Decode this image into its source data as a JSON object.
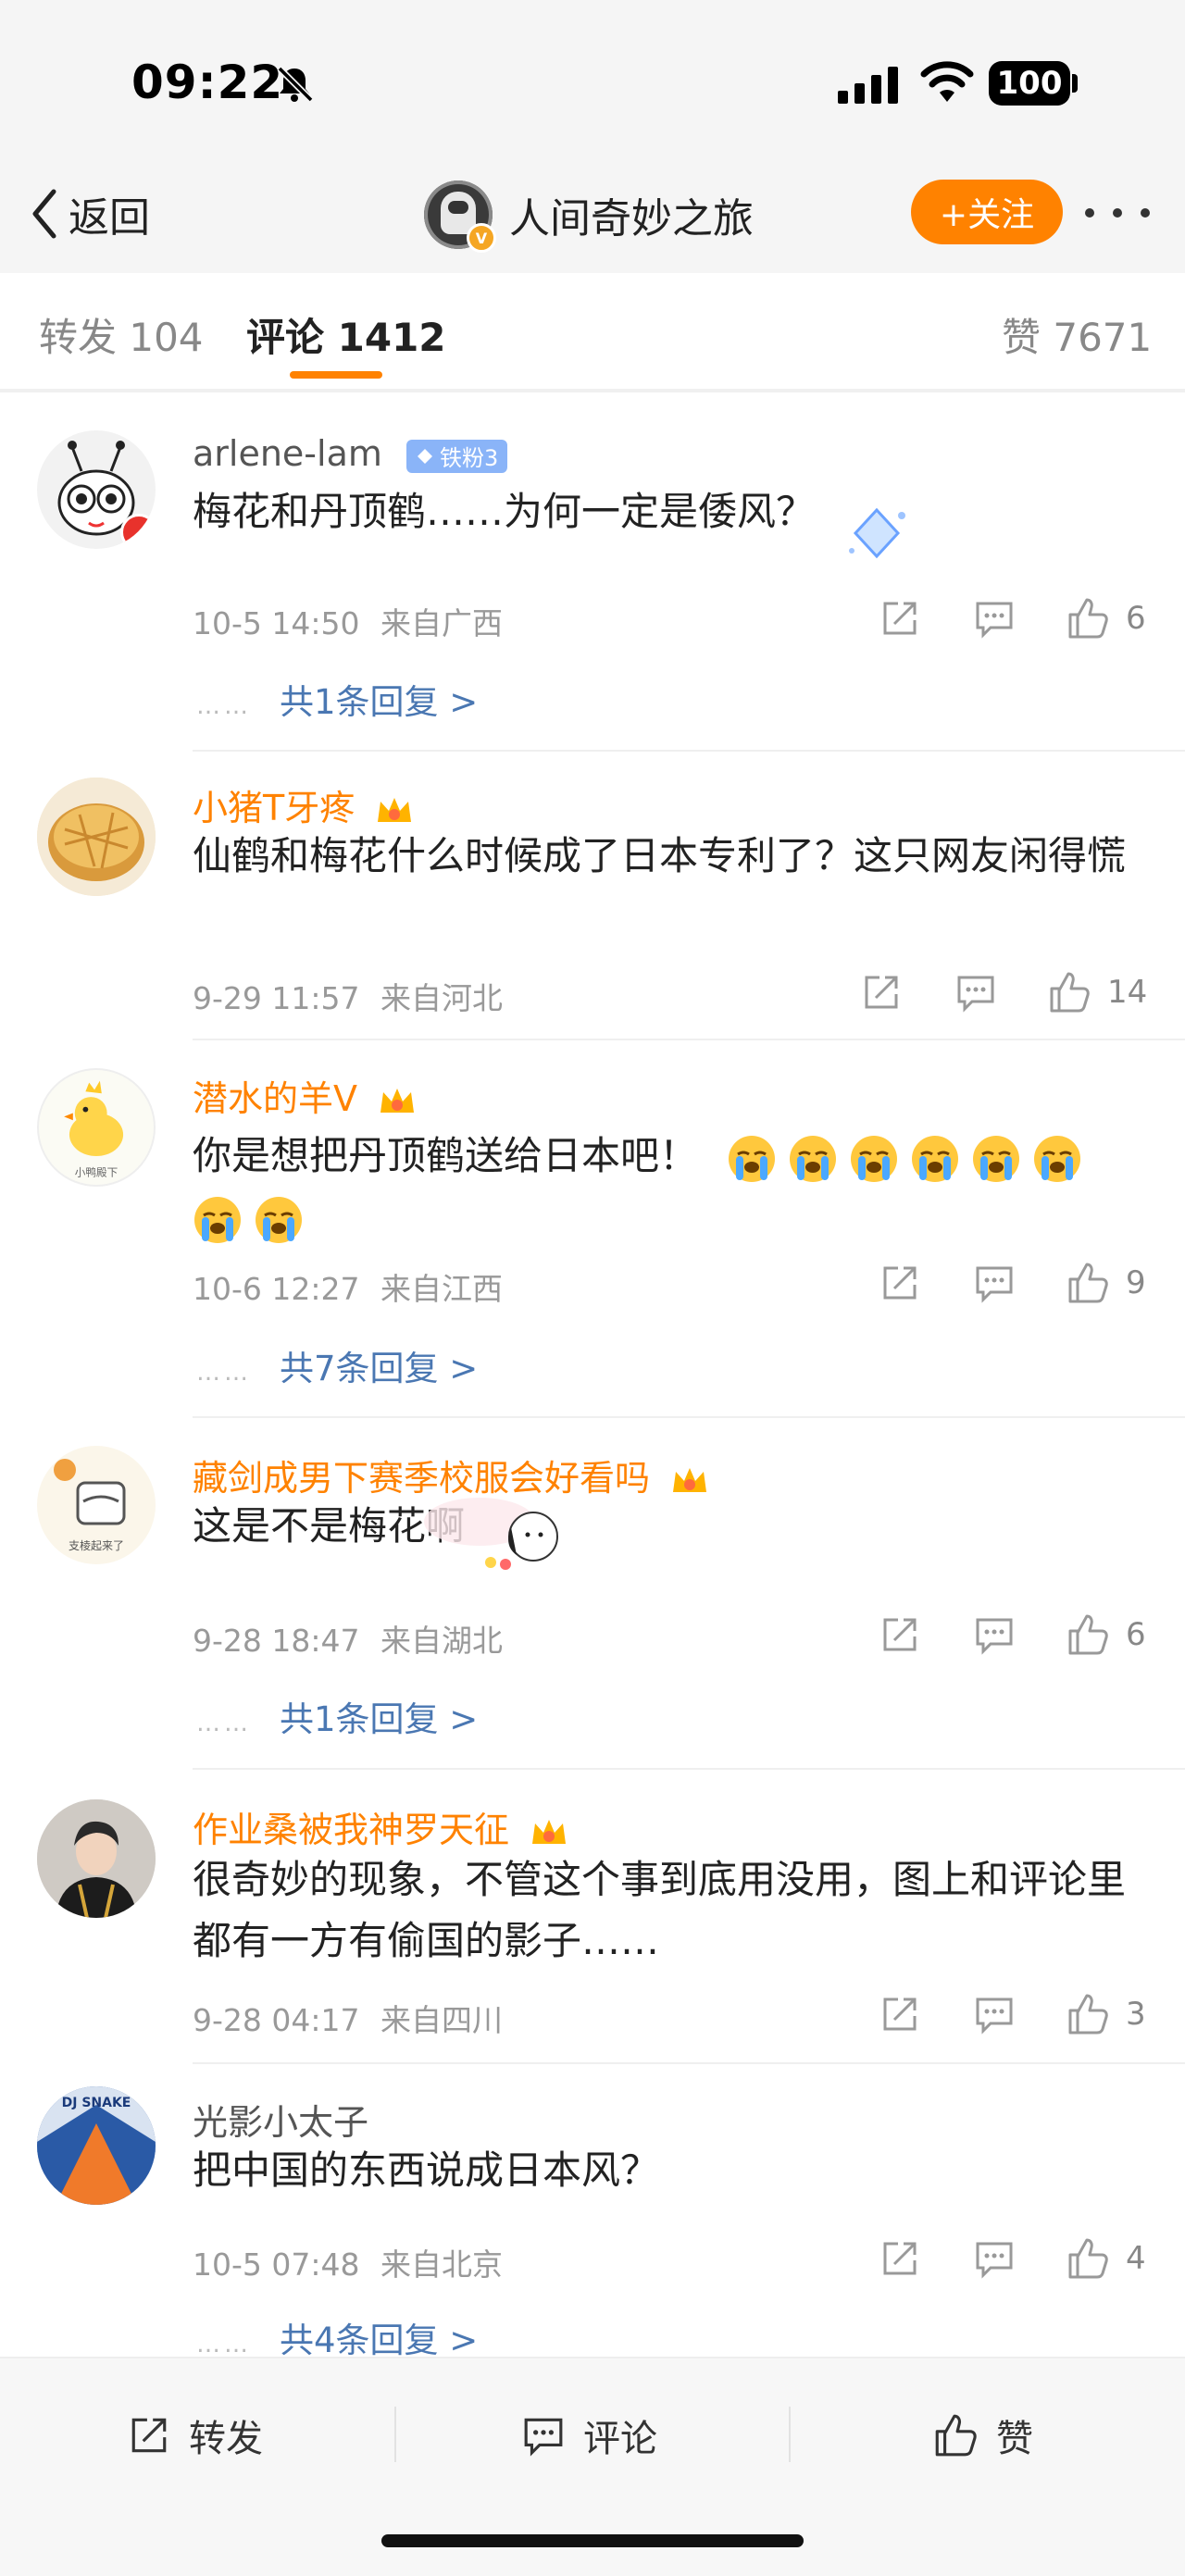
{
  "status": {
    "time": "09:22",
    "battery": "100"
  },
  "nav": {
    "back_label": "返回",
    "title": "人间奇妙之旅",
    "follow_label": "+关注"
  },
  "tabs": [
    {
      "label": "转发 104"
    },
    {
      "label": "评论 1412"
    },
    {
      "label": "赞 7671"
    }
  ],
  "comments": [
    {
      "user": "arlene-lam",
      "badge": "铁粉3",
      "text": "梅花和丹顶鹤……为何一定是倭风？",
      "time": "10-5 14:50",
      "location": "来自广西",
      "likes": "6",
      "replies": "共1条回复 >"
    },
    {
      "user": "小猪T牙疼",
      "text": "仙鹤和梅花什么时候成了日本专利了？这只网友闲得慌",
      "time": "9-29 11:57",
      "location": "来自河北",
      "likes": "14"
    },
    {
      "user": "潜水的羊V",
      "text": "你是想把丹顶鹤送给日本吧！",
      "time": "10-6 12:27",
      "location": "来自江西",
      "likes": "9",
      "replies": "共7条回复 >"
    },
    {
      "user": "藏剑成男下赛季校服会好看吗",
      "text": "这是不是梅花啊",
      "time": "9-28 18:47",
      "location": "来自湖北",
      "likes": "6",
      "replies": "共1条回复 >"
    },
    {
      "user": "作业桑被我神罗天征",
      "text": "很奇妙的现象，不管这个事到底用没用，图上和评论里都有一方有偷国的影子……",
      "time": "9-28 04:17",
      "location": "来自四川",
      "likes": "3"
    },
    {
      "user": "光影小太子",
      "text": "把中国的东西说成日本风？",
      "time": "10-5 07:48",
      "location": "来自北京",
      "likes": "4",
      "replies": "共4条回复 >"
    }
  ],
  "bottom": {
    "repost": "转发",
    "comment": "评论",
    "like": "赞"
  },
  "colors": {
    "accent": "#ff8200",
    "link": "#4a77b2",
    "vip_name": "#ff8200"
  },
  "icons": [
    "bell-slash-icon",
    "signal-icon",
    "wifi-icon",
    "back-chevron-icon",
    "more-dots-icon",
    "share-icon",
    "comment-icon",
    "like-icon"
  ]
}
